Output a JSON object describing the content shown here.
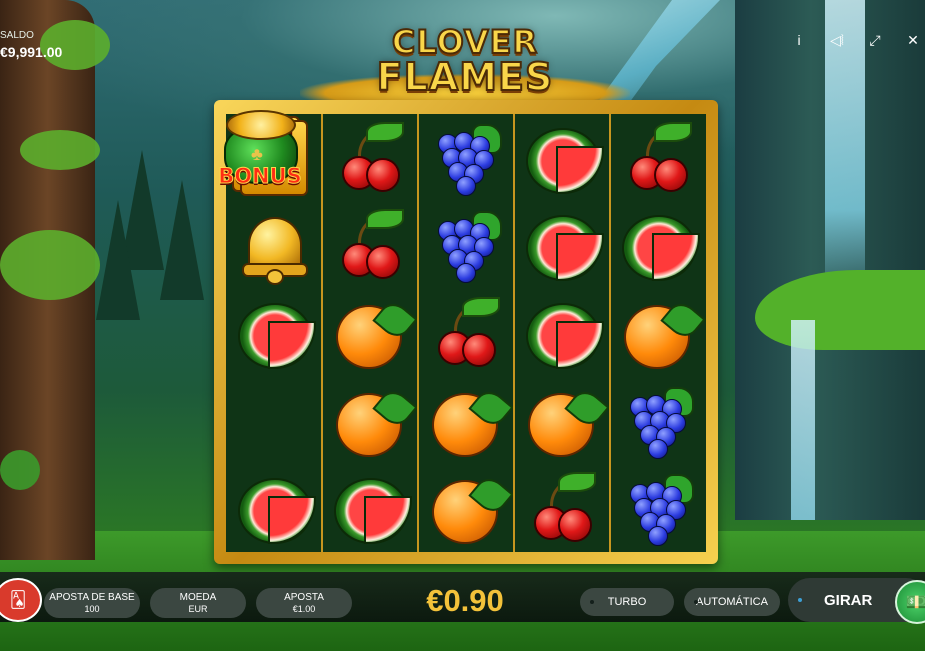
{
  "game": {
    "logo": {
      "line1": "CLOVER",
      "line2": "FLAMES"
    }
  },
  "balance": {
    "label": "SALDO",
    "value": "€9,991.00"
  },
  "top_icons": [
    "info-icon",
    "sound-icon",
    "fullscreen-icon",
    "close-icon"
  ],
  "top_icon_glyphs": {
    "info": "i",
    "sound": "◁⦚",
    "fullscreen": "⤢",
    "close": "✕"
  },
  "reels": [
    [
      "seven",
      "bell",
      "melon",
      "bonus",
      "melon"
    ],
    [
      "cherry",
      "cherry",
      "orange",
      "orange",
      "melon"
    ],
    [
      "grape",
      "grape",
      "cherry",
      "orange",
      "orange"
    ],
    [
      "melon",
      "melon",
      "melon",
      "orange",
      "cherry"
    ],
    [
      "cherry",
      "melon",
      "orange",
      "grape",
      "grape"
    ]
  ],
  "symbols": {
    "seven_glyph": "7",
    "bonus_text": "BONUS",
    "clover_glyph": "♣"
  },
  "controls": {
    "base_bet_label": "APOSTA DE BASE",
    "base_bet_value": "100",
    "currency_label": "MOEDA",
    "currency_value": "EUR",
    "bet_label": "APOSTA",
    "bet_value": "€1.00",
    "total_bet": "€0.90",
    "turbo_label": "TURBO",
    "auto_label": "AUTOMÁTICA",
    "spin_label": "GIRAR",
    "paytable_icon": "cards-icon",
    "paytable_glyph": "🂡",
    "spin_icon_glyph": "💵"
  },
  "colors": {
    "accent_gold": "#f3c23a",
    "reel_bg": "#0f3416",
    "frame_gold": "#e0a826",
    "pill_bg": "#3b4741"
  }
}
